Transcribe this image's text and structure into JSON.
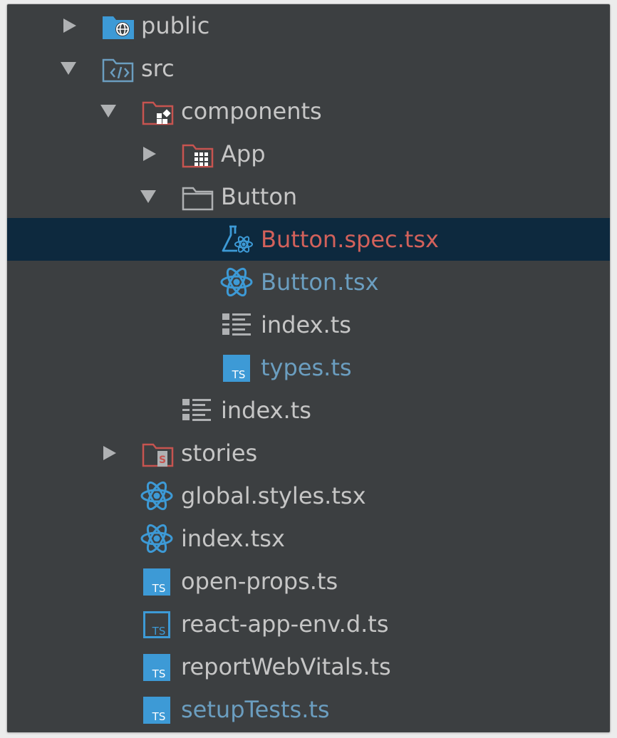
{
  "colors": {
    "panel_bg": "#3c3f41",
    "selected_bg": "#0d293e",
    "text_default": "#c6c6c6",
    "text_modified": "#6b9ec0",
    "text_error": "#d2615b",
    "icon_blue": "#3d9ad6",
    "icon_red": "#c75450",
    "icon_gray": "#afb1b3"
  },
  "tree": {
    "items": [
      {
        "label": "public",
        "icon": "web-folder-icon",
        "state": "collapsed"
      },
      {
        "label": "src",
        "icon": "source-folder-icon",
        "state": "expanded"
      },
      {
        "label": "components",
        "icon": "components-folder-icon",
        "state": "expanded"
      },
      {
        "label": "App",
        "icon": "grid-folder-icon",
        "state": "collapsed"
      },
      {
        "label": "Button",
        "icon": "folder-icon",
        "state": "expanded"
      },
      {
        "label": "Button.spec.tsx",
        "icon": "react-test-icon",
        "status": "error",
        "selected": true
      },
      {
        "label": "Button.tsx",
        "icon": "react-icon",
        "status": "modified"
      },
      {
        "label": "index.ts",
        "icon": "index-file-icon"
      },
      {
        "label": "types.ts",
        "icon": "typescript-icon",
        "status": "modified"
      },
      {
        "label": "index.ts",
        "icon": "index-file-icon"
      },
      {
        "label": "stories",
        "icon": "stories-folder-icon",
        "state": "collapsed"
      },
      {
        "label": "global.styles.tsx",
        "icon": "react-icon"
      },
      {
        "label": "index.tsx",
        "icon": "react-icon"
      },
      {
        "label": "open-props.ts",
        "icon": "typescript-icon"
      },
      {
        "label": "react-app-env.d.ts",
        "icon": "typescript-definition-icon"
      },
      {
        "label": "reportWebVitals.ts",
        "icon": "typescript-icon"
      },
      {
        "label": "setupTests.ts",
        "icon": "typescript-icon",
        "status": "modified"
      }
    ]
  }
}
